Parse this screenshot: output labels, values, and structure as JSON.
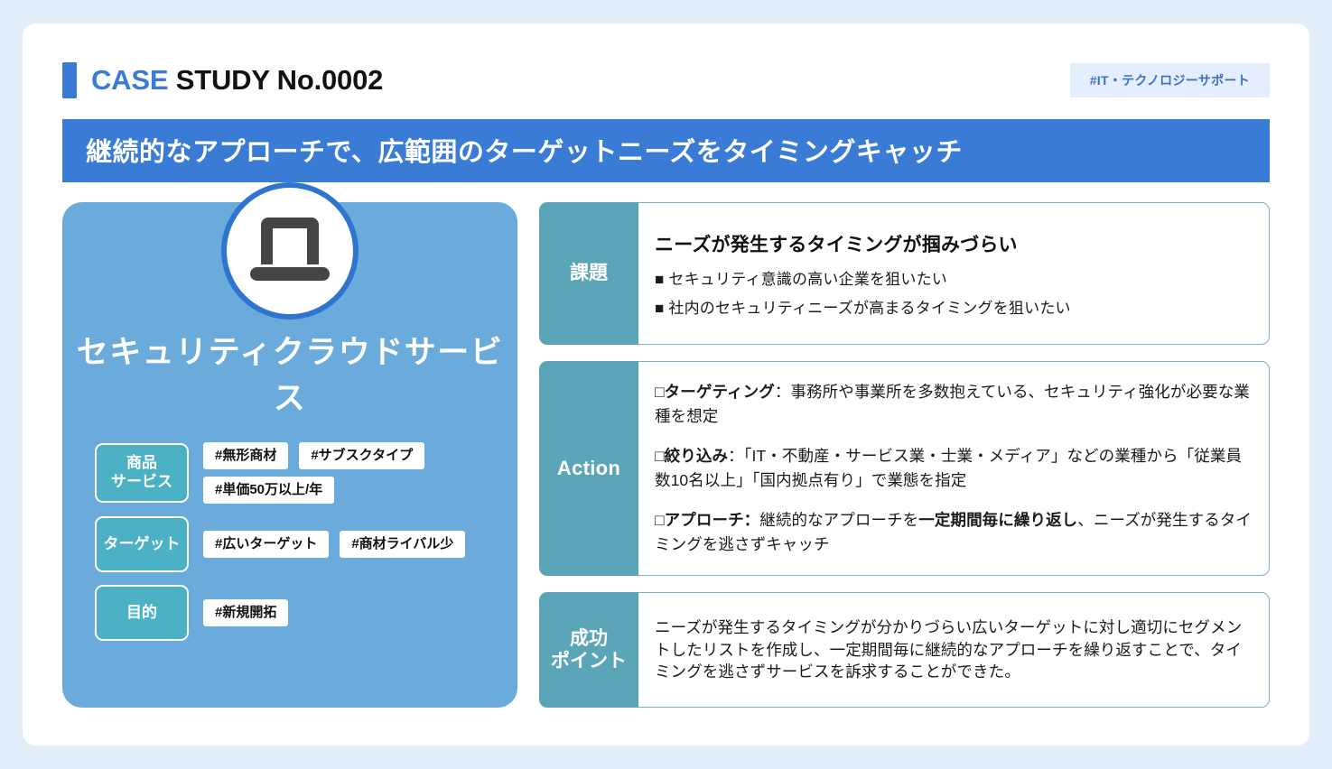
{
  "header": {
    "case_label": "CASE",
    "study_label": " STUDY No.0002",
    "tag_badge": "#IT・テクノロジーサポート",
    "marker_color": "#3a7bd5"
  },
  "headline": "継続的なアプローチで、広範囲のターゲットニーズをタイミングキャッチ",
  "product": {
    "icon": "laptop-icon",
    "name": "セキュリティクラウドサービス",
    "attributes": [
      {
        "label": "商品\nサービス",
        "label_line1": "商品",
        "label_line2": "サービス",
        "tags": [
          "#無形商材",
          "#サブスクタイプ",
          "#単価50万以上/年"
        ]
      },
      {
        "label": "ターゲット",
        "label_line1": "ターゲット",
        "label_line2": "",
        "tags": [
          "#広いターゲット",
          "#商材ライバル少"
        ]
      },
      {
        "label": "目的",
        "label_line1": "目的",
        "label_line2": "",
        "tags": [
          "#新規開拓"
        ]
      }
    ]
  },
  "sections": {
    "issue": {
      "label": "課題",
      "heading": "ニーズが発生するタイミングが掴みづらい",
      "items": [
        "■ セキュリティ意識の高い企業を狙いたい",
        "■ 社内のセキュリティニーズが高まるタイミングを狙いたい"
      ]
    },
    "action": {
      "label": "Action",
      "paragraphs": [
        {
          "prefix": "□",
          "strong": "ターゲティング",
          "rest": "：事務所や事業所を多数抱えている、セキュリティ強化が必要な業種を想定"
        },
        {
          "prefix": "□",
          "strong": "絞り込み",
          "rest": "：「IT・不動産・サービス業・士業・メディア」などの業種から「従業員数10名以上」「国内拠点有り」で業態を指定"
        },
        {
          "prefix": "□",
          "strong": "アプローチ：",
          "rest": "継続的なアプローチを",
          "strong2": "一定期間毎に繰り返し",
          "rest2": "、ニーズが発生するタイミングを逃さずキャッチ"
        }
      ]
    },
    "success": {
      "label_line1": "成功",
      "label_line2": "ポイント",
      "text": "ニーズが発生するタイミングが分かりづらい広いターゲットに対し適切にセグメントしたリストを作成し、一定期間毎に継続的なアプローチを繰り返すことで、タイミングを逃さずサービスを訴求することができた。"
    }
  },
  "colors": {
    "page_background": "#e2edfa",
    "card_background": "#ffffff",
    "accent_blue": "#3a7bd5",
    "panel_blue": "#6aabdb",
    "teal_label": "#5ba5b9",
    "attr_teal": "#4cb1c5",
    "badge_background": "#e5eefc",
    "badge_text": "#3a70c8"
  }
}
